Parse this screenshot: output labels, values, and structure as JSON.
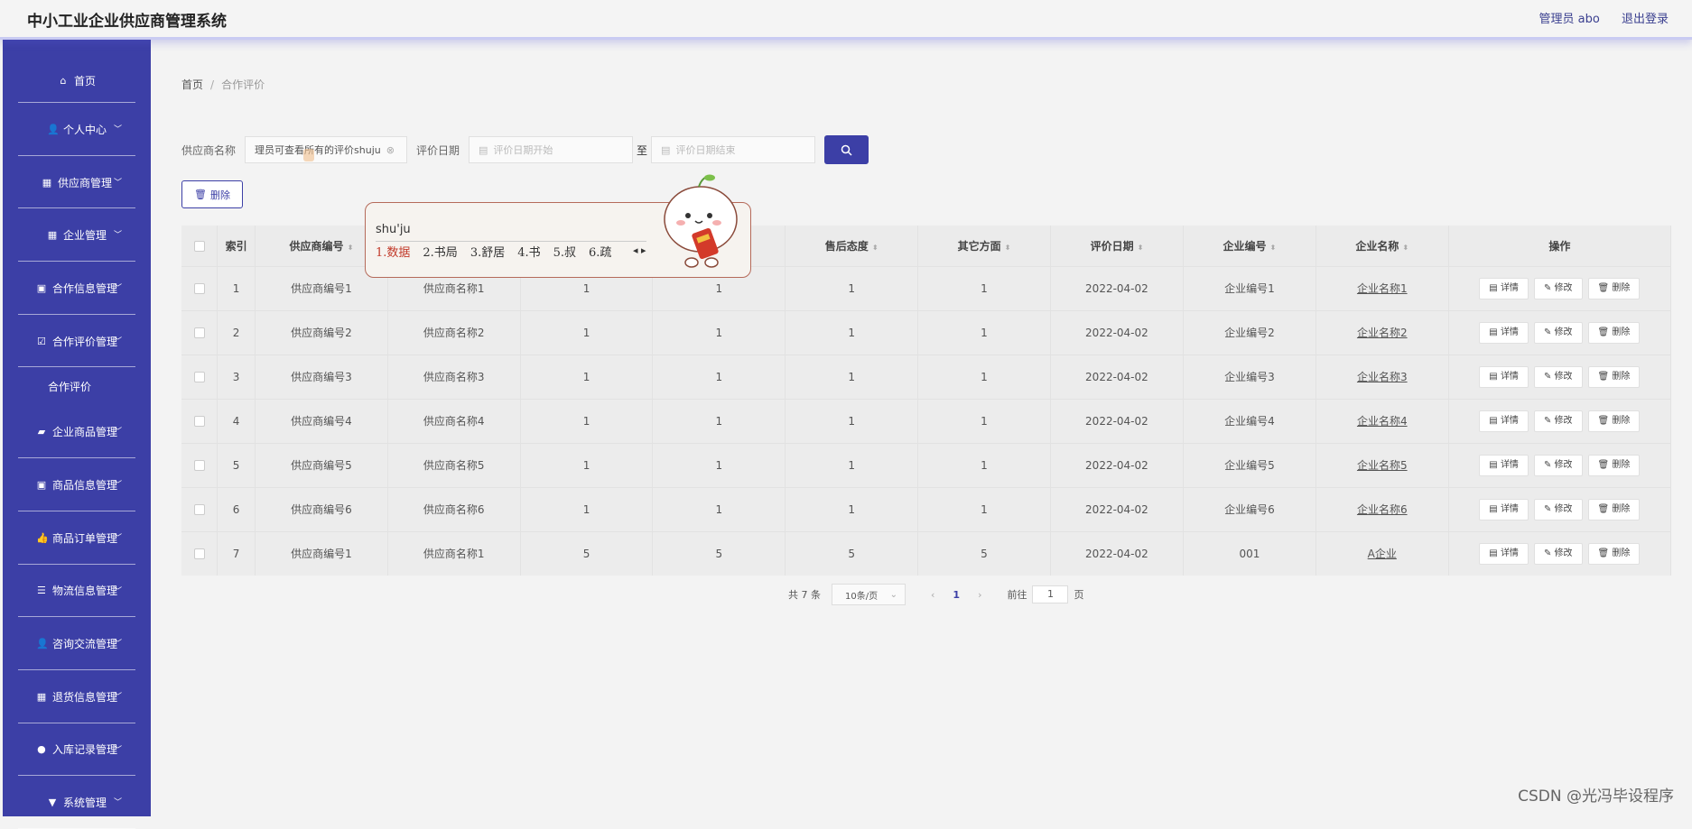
{
  "header": {
    "app_title": "中小工业企业供应商管理系统",
    "user_label": "管理员 abo",
    "logout_label": "退出登录"
  },
  "sidebar": {
    "items": [
      {
        "label": "首页",
        "icon": "home-icon"
      },
      {
        "label": "个人中心",
        "icon": "user-icon"
      },
      {
        "label": "供应商管理",
        "icon": "grid-icon"
      },
      {
        "label": "企业管理",
        "icon": "grid-icon"
      },
      {
        "label": "合作信息管理",
        "icon": "clipboard-icon"
      },
      {
        "label": "合作评价管理",
        "icon": "check-square-icon"
      },
      {
        "label": "企业商品管理",
        "icon": "briefcase-icon"
      },
      {
        "label": "商品信息管理",
        "icon": "clipboard-icon"
      },
      {
        "label": "商品订单管理",
        "icon": "thumbs-up-icon"
      },
      {
        "label": "物流信息管理",
        "icon": "list-icon"
      },
      {
        "label": "咨询交流管理",
        "icon": "user-icon"
      },
      {
        "label": "退货信息管理",
        "icon": "grid-icon"
      },
      {
        "label": "入库记录管理",
        "icon": "bulb-icon"
      },
      {
        "label": "系统管理",
        "icon": "bookmark-icon"
      }
    ],
    "sub_item": "合作评价"
  },
  "breadcrumb": {
    "home": "首页",
    "current": "合作评价"
  },
  "search": {
    "name_label": "供应商名称",
    "name_value": "理员可查看所有的评价shuju",
    "date_label": "评价日期",
    "date_start_placeholder": "评价日期开始",
    "to_label": "至",
    "date_end_placeholder": "评价日期结束"
  },
  "delete_button": "删除",
  "table": {
    "headers": [
      "索引",
      "供应商编号",
      "",
      "",
      "",
      "售后态度",
      "其它方面",
      "评价日期",
      "企业编号",
      "企业名称",
      "操作"
    ],
    "rows": [
      [
        "1",
        "供应商编号1",
        "供应商名称1",
        "1",
        "1",
        "1",
        "1",
        "2022-04-02",
        "企业编号1",
        "企业名称1"
      ],
      [
        "2",
        "供应商编号2",
        "供应商名称2",
        "1",
        "1",
        "1",
        "1",
        "2022-04-02",
        "企业编号2",
        "企业名称2"
      ],
      [
        "3",
        "供应商编号3",
        "供应商名称3",
        "1",
        "1",
        "1",
        "1",
        "2022-04-02",
        "企业编号3",
        "企业名称3"
      ],
      [
        "4",
        "供应商编号4",
        "供应商名称4",
        "1",
        "1",
        "1",
        "1",
        "2022-04-02",
        "企业编号4",
        "企业名称4"
      ],
      [
        "5",
        "供应商编号5",
        "供应商名称5",
        "1",
        "1",
        "1",
        "1",
        "2022-04-02",
        "企业编号5",
        "企业名称5"
      ],
      [
        "6",
        "供应商编号6",
        "供应商名称6",
        "1",
        "1",
        "1",
        "1",
        "2022-04-02",
        "企业编号6",
        "企业名称6"
      ],
      [
        "7",
        "供应商编号1",
        "供应商名称1",
        "5",
        "5",
        "5",
        "5",
        "2022-04-02",
        "001",
        "A企业"
      ]
    ],
    "actions": [
      "详情",
      "修改",
      "删除"
    ]
  },
  "pagination": {
    "total": "共 7 条",
    "page_size": "10条/页",
    "current_page": "1",
    "goto_label": "前往",
    "goto_value": "1",
    "page_suffix": "页"
  },
  "ime": {
    "input": "shu'ju",
    "candidates": [
      "1.数据",
      "2.书局",
      "3.舒居",
      "4.书",
      "5.叔",
      "6.疏"
    ]
  },
  "watermark": "CSDN @光冯毕设程序"
}
